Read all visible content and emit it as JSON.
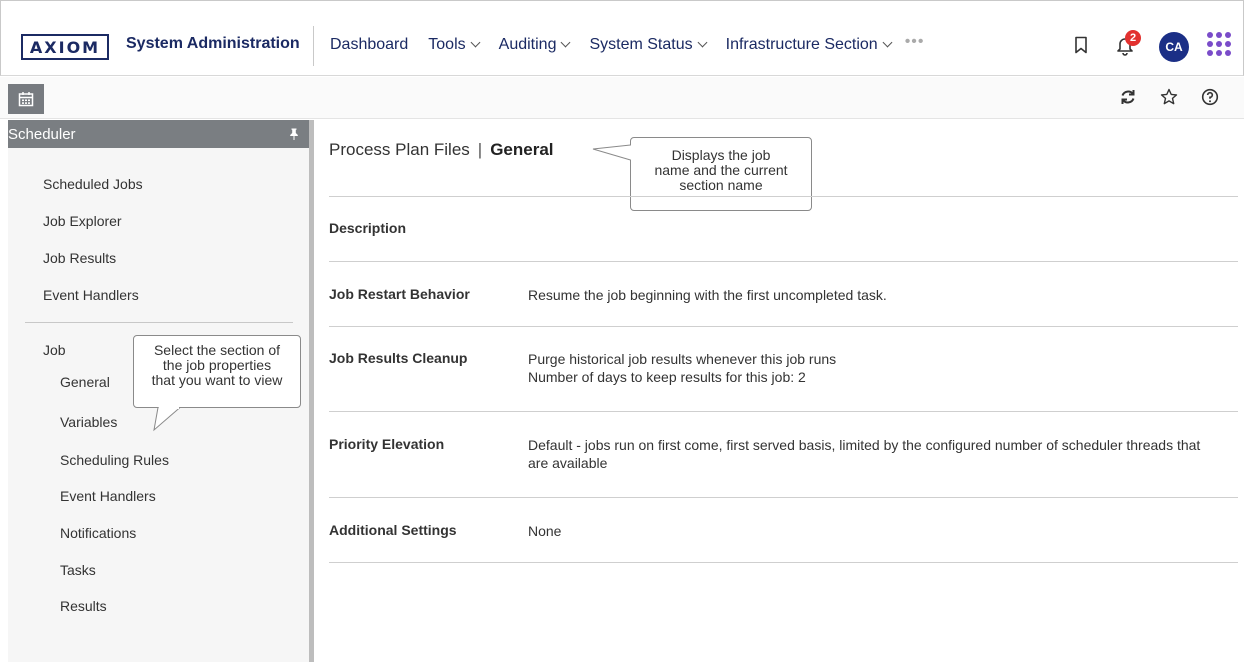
{
  "header": {
    "logo_text": "AXIOM",
    "app_title": "System Administration",
    "nav": [
      {
        "label": "Dashboard",
        "has_menu": false
      },
      {
        "label": "Tools",
        "has_menu": true
      },
      {
        "label": "Auditing",
        "has_menu": true
      },
      {
        "label": "System Status",
        "has_menu": true
      },
      {
        "label": "Infrastructure Section",
        "has_menu": true
      }
    ],
    "more_label": "•••",
    "notification_count": "2",
    "avatar_initials": "CA",
    "accent_color": "#1b2a63",
    "avatar_color": "#1b2f86",
    "badge_color": "#e2312f"
  },
  "toolbar": {
    "left_icon": "calendar-icon",
    "right_icons": [
      "refresh-icon",
      "star-icon",
      "help-icon"
    ]
  },
  "sidebar": {
    "title": "Scheduler",
    "top_items": [
      "Scheduled Jobs",
      "Job Explorer",
      "Job Results",
      "Event Handlers"
    ],
    "group_label": "Job",
    "sub_items": [
      "General",
      "Variables",
      "Scheduling Rules",
      "Event Handlers",
      "Notifications",
      "Tasks",
      "Results"
    ]
  },
  "callouts": {
    "sidebar_lines": [
      "Select the section of",
      "the job properties",
      "that you want to view"
    ],
    "title_lines": [
      "Displays the job",
      "name and the current",
      "section name"
    ]
  },
  "main": {
    "job_name": "Process Plan Files",
    "separator": "|",
    "section_name": "General",
    "rows": [
      {
        "label": "Description",
        "lines": []
      },
      {
        "label": "Job Restart Behavior",
        "lines": [
          "Resume the job beginning with the first uncompleted task."
        ]
      },
      {
        "label": "Job Results Cleanup",
        "lines": [
          "Purge historical job results whenever this job runs",
          "Number of days to keep results for this job: 2"
        ]
      },
      {
        "label": "Priority Elevation",
        "lines": [
          "Default - jobs run on first come, first served basis, limited by the configured number of scheduler threads that",
          "are available"
        ]
      },
      {
        "label": "Additional Settings",
        "lines": [
          "None"
        ]
      }
    ]
  }
}
